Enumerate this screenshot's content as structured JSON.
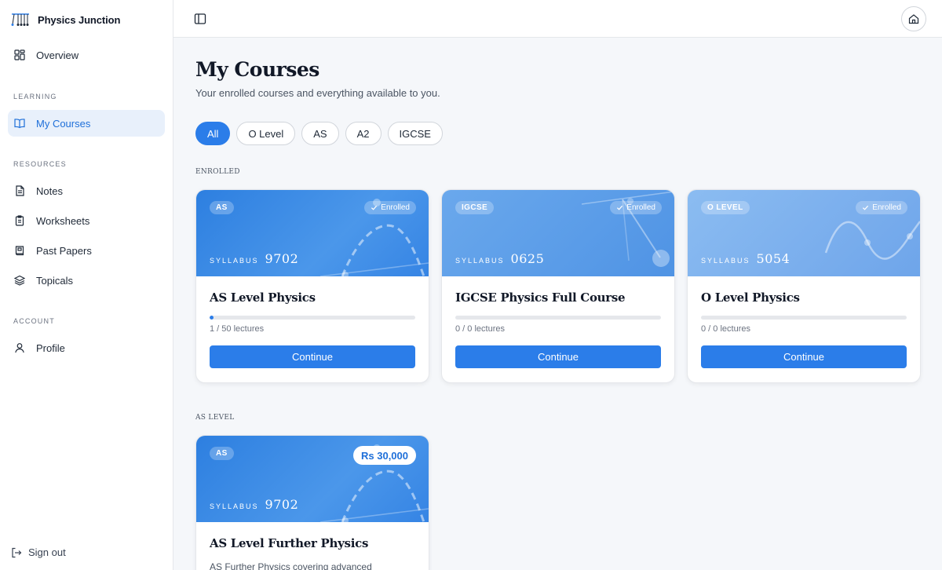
{
  "brand": {
    "name": "Physics Junction"
  },
  "sidebar": {
    "overview": "Overview",
    "learning_label": "LEARNING",
    "my_courses": "My Courses",
    "resources_label": "RESOURCES",
    "notes": "Notes",
    "worksheets": "Worksheets",
    "past_papers": "Past Papers",
    "topicals": "Topicals",
    "account_label": "ACCOUNT",
    "profile": "Profile",
    "sign_out": "Sign out"
  },
  "header": {
    "title": "My Courses",
    "subtitle": "Your enrolled courses and everything available to you."
  },
  "filters": [
    "All",
    "O Level",
    "AS",
    "A2",
    "IGCSE"
  ],
  "active_filter": "All",
  "groups": {
    "enrolled": "ENROLLED",
    "as_level": "AS LEVEL"
  },
  "syllabus_label": "SYLLABUS",
  "enrolled_courses": [
    {
      "level": "AS",
      "badge": "Enrolled",
      "syllabus": "9702",
      "title": "AS Level Physics",
      "progress": 0.02,
      "lectures": "1 / 50 lectures",
      "button": "Continue"
    },
    {
      "level": "IGCSE",
      "badge": "Enrolled",
      "syllabus": "0625",
      "title": "IGCSE Physics Full Course",
      "progress": 0,
      "lectures": "0 / 0 lectures",
      "button": "Continue"
    },
    {
      "level": "O LEVEL",
      "badge": "Enrolled",
      "syllabus": "5054",
      "title": "O Level Physics",
      "progress": 0,
      "lectures": "0 / 0 lectures",
      "button": "Continue"
    }
  ],
  "as_courses": [
    {
      "level": "AS",
      "price": "Rs 30,000",
      "syllabus": "9702",
      "title": "AS Level Further Physics",
      "description": "AS Further Physics covering advanced"
    }
  ],
  "colors": {
    "accent": "#2b7de9",
    "active_nav_bg": "#e8f0fb"
  },
  "icons": {
    "logo": "pendulum-logo-icon",
    "overview": "grid-icon",
    "my_courses": "book-open-icon",
    "notes": "file-text-icon",
    "worksheets": "clipboard-icon",
    "past_papers": "book-icon",
    "topicals": "layers-icon",
    "profile": "user-icon",
    "sign_out": "log-out-icon",
    "panel_toggle": "sidebar-panel-icon",
    "home": "home-icon",
    "enrolled_check": "check-icon"
  }
}
